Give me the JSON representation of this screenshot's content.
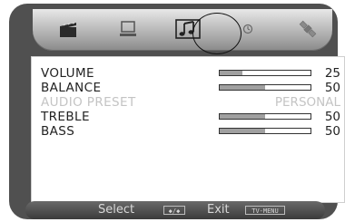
{
  "tabs": [
    {
      "name": "picture",
      "icon": "clapperboard-icon"
    },
    {
      "name": "screen",
      "icon": "monitor-icon"
    },
    {
      "name": "audio",
      "icon": "music-notes-icon",
      "selected": true
    },
    {
      "name": "timer",
      "icon": "clock-icon"
    },
    {
      "name": "setup",
      "icon": "satellite-icon"
    }
  ],
  "audio": {
    "rows": [
      {
        "label": "VOLUME",
        "value": "25",
        "level": 0.25,
        "enabled": true
      },
      {
        "label": "BALANCE",
        "value": "50",
        "level": 0.5,
        "enabled": true
      },
      {
        "label": "AUDIO PRESET",
        "value": "PERSONAL",
        "enabled": false
      },
      {
        "label": "TREBLE",
        "value": "50",
        "level": 0.5,
        "enabled": true
      },
      {
        "label": "BASS",
        "value": "50",
        "level": 0.5,
        "enabled": true
      }
    ]
  },
  "footer": {
    "select_label": "Select",
    "select_key": "◆/◆",
    "exit_label": "Exit",
    "exit_key": "TV-MENU"
  },
  "colors": {
    "frame": "#505050",
    "bar_fill": "#a0a0a0",
    "disabled_text": "#c4c4c4"
  }
}
